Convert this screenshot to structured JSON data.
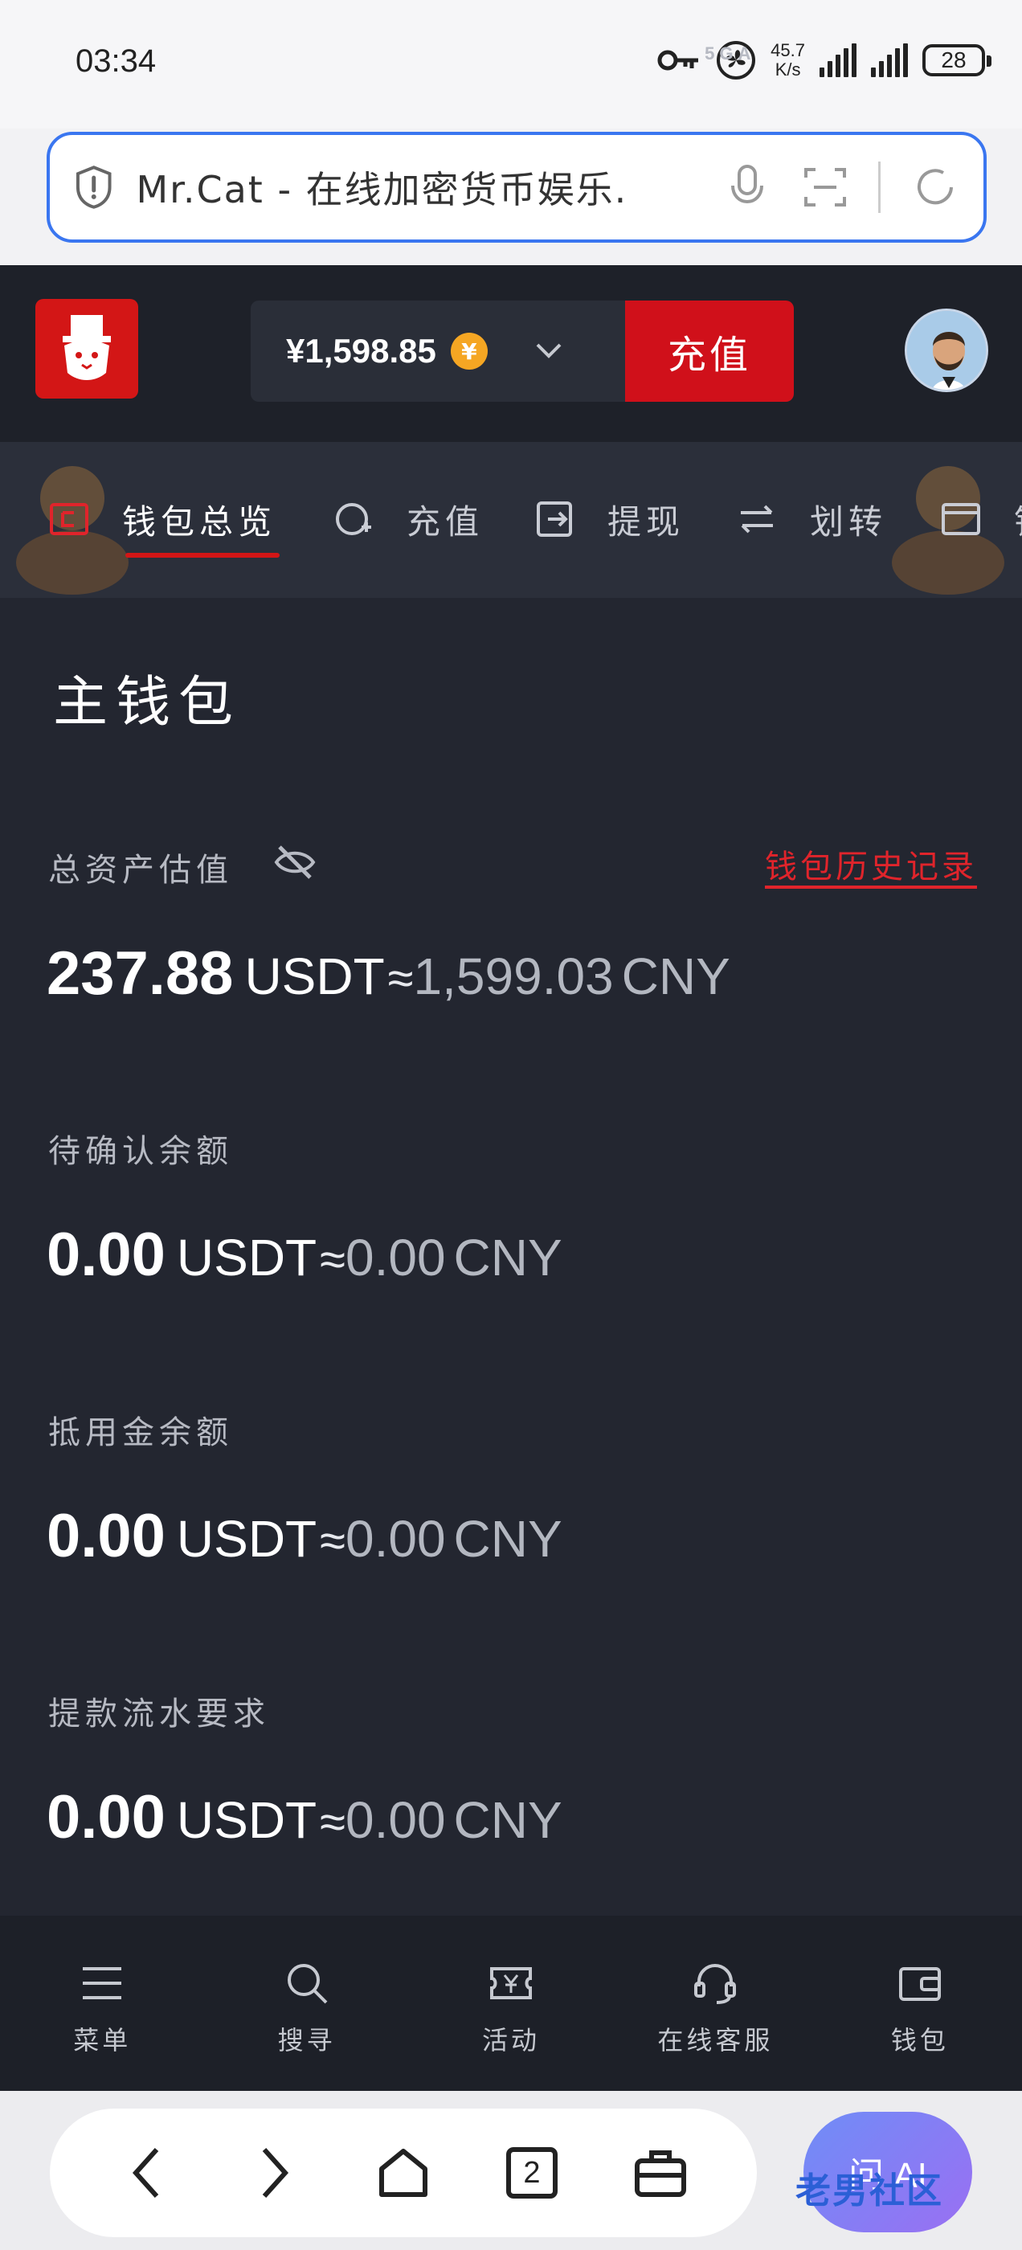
{
  "status_bar": {
    "time": "03:34",
    "net_speed_value": "45.7",
    "net_speed_unit": "K/s",
    "sim1_label": "5GA",
    "sim2_label": "5G",
    "battery": "28"
  },
  "browser": {
    "url_title": "Mr.Cat - 在线加密货币娱乐.",
    "tab_count": "2",
    "ai_button_label": "问 AI",
    "watermark": "老男社区"
  },
  "header": {
    "balance": "¥1,598.85",
    "currency_symbol": "¥",
    "deposit_label": "充值"
  },
  "tabs": [
    {
      "label": "钱包总览",
      "active": true
    },
    {
      "label": "充值",
      "active": false
    },
    {
      "label": "提现",
      "active": false
    },
    {
      "label": "划转",
      "active": false
    },
    {
      "label": "钱",
      "active": false
    }
  ],
  "wallet": {
    "title": "主钱包",
    "history_link": "钱包历史记录",
    "rows": [
      {
        "label": "总资产估值",
        "amount": "237.88",
        "unit": "USDT",
        "approx": "≈",
        "cny": "1,599.03",
        "cny_unit": "CNY"
      },
      {
        "label": "待确认余额",
        "amount": "0.00",
        "unit": "USDT",
        "approx": "≈",
        "cny": "0.00",
        "cny_unit": "CNY"
      },
      {
        "label": "抵用金余额",
        "amount": "0.00",
        "unit": "USDT",
        "approx": "≈",
        "cny": "0.00",
        "cny_unit": "CNY"
      },
      {
        "label": "提款流水要求",
        "amount": "0.00",
        "unit": "USDT",
        "approx": "≈",
        "cny": "0.00",
        "cny_unit": "CNY"
      }
    ]
  },
  "bottom_nav": [
    {
      "label": "菜单",
      "icon": "menu-icon"
    },
    {
      "label": "搜寻",
      "icon": "search-icon"
    },
    {
      "label": "活动",
      "icon": "ticket-icon"
    },
    {
      "label": "在线客服",
      "icon": "headset-icon"
    },
    {
      "label": "钱包",
      "icon": "wallet-icon"
    }
  ],
  "colors": {
    "accent_red": "#d0101a",
    "header_bg": "#1e2129",
    "panel_bg": "#232630",
    "link_blue": "#3a76f0"
  }
}
